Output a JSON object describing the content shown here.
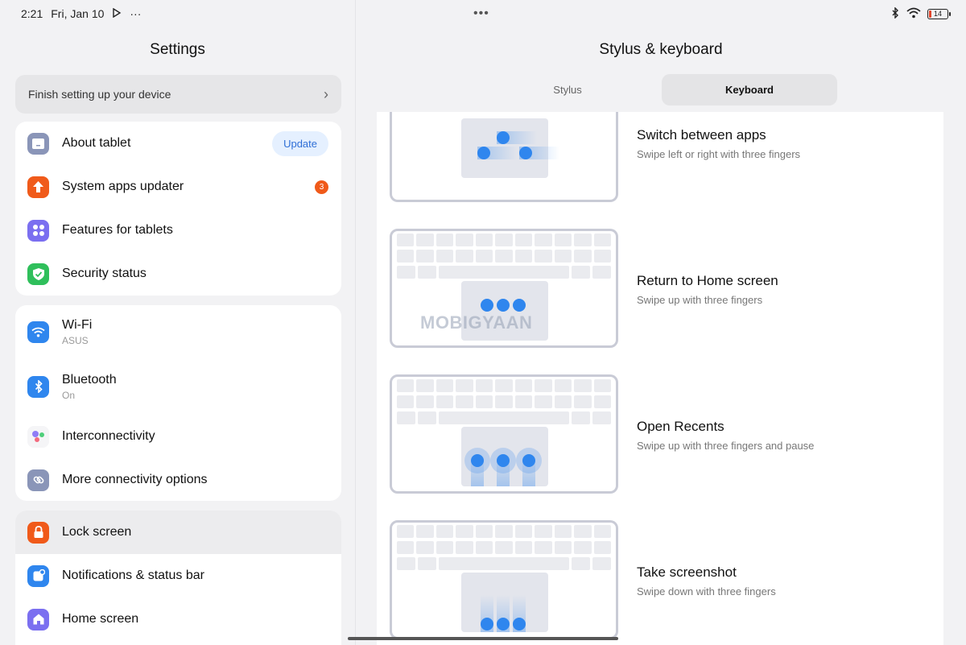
{
  "status": {
    "time": "2:21",
    "date": "Fri, Jan 10",
    "more": "···",
    "battery": "14"
  },
  "left": {
    "title": "Settings",
    "setup": {
      "label": "Finish setting up your device"
    },
    "group1": [
      {
        "label": "About tablet",
        "action": "Update",
        "icon_color": "#8a95b8"
      },
      {
        "label": "System apps updater",
        "badge": "3",
        "icon_color": "#f05a1a"
      },
      {
        "label": "Features for tablets",
        "icon_color": "#7b6ff0"
      },
      {
        "label": "Security status",
        "icon_color": "#2fbf5b"
      }
    ],
    "group2": [
      {
        "label": "Wi-Fi",
        "sub": "ASUS",
        "icon_color": "#2f86ee"
      },
      {
        "label": "Bluetooth",
        "sub": "On",
        "icon_color": "#2f86ee"
      },
      {
        "label": "Interconnectivity",
        "icon_color": "#f5f5f7"
      },
      {
        "label": "More connectivity options",
        "icon_color": "#8a95b8"
      }
    ],
    "group3": [
      {
        "label": "Lock screen",
        "icon_color": "#f05a1a"
      },
      {
        "label": "Notifications & status bar",
        "icon_color": "#2f86ee"
      },
      {
        "label": "Home screen",
        "icon_color": "#7b6ff0"
      }
    ]
  },
  "right": {
    "title": "Stylus & keyboard",
    "tabs": [
      {
        "label": "Stylus",
        "active": false
      },
      {
        "label": "Keyboard",
        "active": true
      }
    ],
    "gestures": [
      {
        "title": "Switch between apps",
        "desc": "Swipe left or right with three fingers"
      },
      {
        "title": "Return to Home screen",
        "desc": "Swipe up with three fingers"
      },
      {
        "title": "Open Recents",
        "desc": "Swipe up with three fingers and pause"
      },
      {
        "title": "Take screenshot",
        "desc": "Swipe down with three fingers"
      }
    ],
    "watermark": "MOBIGYAAN"
  },
  "colors": {
    "accent": "#2f86ee",
    "badge": "#f05a1a",
    "background": "#f2f2f4"
  }
}
